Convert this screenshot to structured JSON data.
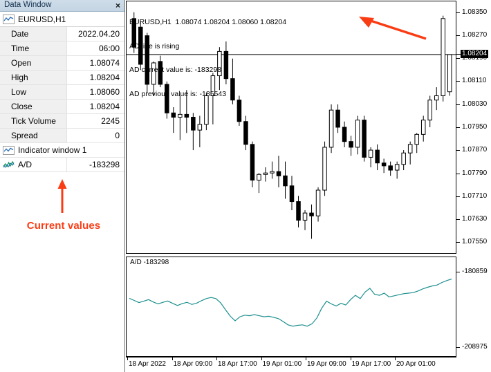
{
  "data_window": {
    "title": "Data Window",
    "close_label": "×",
    "symbol_row": {
      "icon": "chart-line-icon",
      "label": "EURUSD,H1"
    },
    "rows": [
      {
        "label": "Date",
        "value": "2022.04.20"
      },
      {
        "label": "Time",
        "value": "06:00"
      },
      {
        "label": "Open",
        "value": "1.08074"
      },
      {
        "label": "High",
        "value": "1.08204"
      },
      {
        "label": "Low",
        "value": "1.08060"
      },
      {
        "label": "Close",
        "value": "1.08204"
      },
      {
        "label": "Tick Volume",
        "value": "2245"
      },
      {
        "label": "Spread",
        "value": "0"
      }
    ],
    "group": {
      "icon": "chart-line-icon",
      "label": "Indicator window 1"
    },
    "indicator_row": {
      "icon": "indicator-zigzag-icon",
      "label": "A/D",
      "value": "-183298"
    },
    "annotation": {
      "text": "Current values",
      "color": "#fa3c14",
      "arrow": "arrow-up-icon"
    }
  },
  "chart": {
    "header_lines": [
      "EURUSD,H1  1.08074 1.08204 1.08060 1.08204",
      "AD line is rising",
      "AD current value is: -183298",
      "AD previous value is: -185543"
    ],
    "annotation_arrow": "arrow-up-left-icon",
    "current_price": "1.08204",
    "indicator_label": "A/D -183298"
  },
  "chart_data": {
    "type": "candlestick",
    "title": "EURUSD,H1",
    "symbol": "EURUSD",
    "timeframe": "H1",
    "xlabel": "",
    "ylabel": "",
    "grid": false,
    "legend": "none",
    "price_axis": {
      "ticks": [
        "1.08350",
        "1.08270",
        "1.08190",
        "1.08110",
        "1.08030",
        "1.07950",
        "1.07870",
        "1.07790",
        "1.07710",
        "1.07630",
        "1.07550"
      ],
      "ylim": [
        1.0751,
        1.0839
      ],
      "current_price": "1.08204",
      "current_price_highlight": true
    },
    "time_axis": {
      "ticks": [
        "18 Apr 2022",
        "18 Apr 09:00",
        "18 Apr 17:00",
        "19 Apr 01:00",
        "19 Apr 09:00",
        "19 Apr 17:00",
        "20 Apr 01:00"
      ]
    },
    "ohlc": [
      {
        "o": 1.0833,
        "h": 1.08352,
        "l": 1.0821,
        "c": 1.0823
      },
      {
        "o": 1.083,
        "h": 1.0832,
        "l": 1.0815,
        "c": 1.0817
      },
      {
        "o": 1.0827,
        "h": 1.0828,
        "l": 1.0807,
        "c": 1.081
      },
      {
        "o": 1.081,
        "h": 1.0818,
        "l": 1.0806,
        "c": 1.08175
      },
      {
        "o": 1.0818,
        "h": 1.082,
        "l": 1.0809,
        "c": 1.081
      },
      {
        "o": 1.081,
        "h": 1.0811,
        "l": 1.0798,
        "c": 1.08
      },
      {
        "o": 1.08,
        "h": 1.0802,
        "l": 1.0793,
        "c": 1.07985
      },
      {
        "o": 1.07985,
        "h": 1.0806,
        "l": 1.07905,
        "c": 1.07995
      },
      {
        "o": 1.07995,
        "h": 1.0808,
        "l": 1.0793,
        "c": 1.07985
      },
      {
        "o": 1.07985,
        "h": 1.08,
        "l": 1.0787,
        "c": 1.0794
      },
      {
        "o": 1.0794,
        "h": 1.0799,
        "l": 1.0788,
        "c": 1.0796
      },
      {
        "o": 1.0796,
        "h": 1.0807,
        "l": 1.0794,
        "c": 1.0806
      },
      {
        "o": 1.0806,
        "h": 1.0814,
        "l": 1.0796,
        "c": 1.0813
      },
      {
        "o": 1.0813,
        "h": 1.0823,
        "l": 1.0808,
        "c": 1.08215
      },
      {
        "o": 1.08215,
        "h": 1.0825,
        "l": 1.081,
        "c": 1.0812
      },
      {
        "o": 1.0812,
        "h": 1.0819,
        "l": 1.0803,
        "c": 1.08045
      },
      {
        "o": 1.08045,
        "h": 1.0806,
        "l": 1.07955,
        "c": 1.0797
      },
      {
        "o": 1.0797,
        "h": 1.0799,
        "l": 1.0787,
        "c": 1.0789
      },
      {
        "o": 1.0789,
        "h": 1.079,
        "l": 1.0774,
        "c": 1.07765
      },
      {
        "o": 1.07765,
        "h": 1.0779,
        "l": 1.0772,
        "c": 1.07785
      },
      {
        "o": 1.07785,
        "h": 1.0781,
        "l": 1.0776,
        "c": 1.0779
      },
      {
        "o": 1.0779,
        "h": 1.0783,
        "l": 1.0777,
        "c": 1.07795
      },
      {
        "o": 1.07795,
        "h": 1.0785,
        "l": 1.0774,
        "c": 1.0778
      },
      {
        "o": 1.0778,
        "h": 1.0783,
        "l": 1.077,
        "c": 1.07745
      },
      {
        "o": 1.07745,
        "h": 1.0778,
        "l": 1.0766,
        "c": 1.0769
      },
      {
        "o": 1.0769,
        "h": 1.0771,
        "l": 1.076,
        "c": 1.07625
      },
      {
        "o": 1.07625,
        "h": 1.0766,
        "l": 1.0759,
        "c": 1.0765
      },
      {
        "o": 1.0765,
        "h": 1.0768,
        "l": 1.0756,
        "c": 1.0764
      },
      {
        "o": 1.0764,
        "h": 1.0774,
        "l": 1.0762,
        "c": 1.0773
      },
      {
        "o": 1.0773,
        "h": 1.079,
        "l": 1.0771,
        "c": 1.0788
      },
      {
        "o": 1.0788,
        "h": 1.0803,
        "l": 1.0786,
        "c": 1.0801
      },
      {
        "o": 1.0801,
        "h": 1.0803,
        "l": 1.0793,
        "c": 1.0795
      },
      {
        "o": 1.0795,
        "h": 1.0797,
        "l": 1.0788,
        "c": 1.079
      },
      {
        "o": 1.079,
        "h": 1.0792,
        "l": 1.0785,
        "c": 1.0788
      },
      {
        "o": 1.0788,
        "h": 1.0799,
        "l": 1.07855,
        "c": 1.07975
      },
      {
        "o": 1.07975,
        "h": 1.0799,
        "l": 1.0783,
        "c": 1.07845
      },
      {
        "o": 1.07845,
        "h": 1.0788,
        "l": 1.0781,
        "c": 1.0787
      },
      {
        "o": 1.0787,
        "h": 1.0789,
        "l": 1.078,
        "c": 1.07825
      },
      {
        "o": 1.07825,
        "h": 1.0784,
        "l": 1.0779,
        "c": 1.07815
      },
      {
        "o": 1.07815,
        "h": 1.0783,
        "l": 1.0778,
        "c": 1.078
      },
      {
        "o": 1.078,
        "h": 1.0783,
        "l": 1.0777,
        "c": 1.0782
      },
      {
        "o": 1.0782,
        "h": 1.0787,
        "l": 1.078,
        "c": 1.0786
      },
      {
        "o": 1.0786,
        "h": 1.079,
        "l": 1.0782,
        "c": 1.0789
      },
      {
        "o": 1.0789,
        "h": 1.0793,
        "l": 1.0786,
        "c": 1.07925
      },
      {
        "o": 1.07925,
        "h": 1.0799,
        "l": 1.079,
        "c": 1.07975
      },
      {
        "o": 1.07975,
        "h": 1.0806,
        "l": 1.0795,
        "c": 1.08045
      },
      {
        "o": 1.08045,
        "h": 1.0809,
        "l": 1.0801,
        "c": 1.0806
      },
      {
        "o": 1.0806,
        "h": 1.0834,
        "l": 1.0804,
        "c": 1.0833
      },
      {
        "o": 1.08074,
        "h": 1.08204,
        "l": 1.0806,
        "c": 1.08204
      }
    ],
    "indicator": {
      "name": "A/D",
      "type": "line",
      "color": "#1d8f8f",
      "current_value": "-183298",
      "previous_value": "-185543",
      "ylim": [
        -208975,
        -180859
      ],
      "yticks": [
        "-180859",
        "-208975"
      ],
      "values": [
        -190500,
        -191300,
        -192100,
        -191600,
        -191000,
        -191900,
        -192600,
        -192000,
        -191500,
        -192400,
        -193200,
        -192500,
        -192000,
        -192800,
        -192300,
        -191400,
        -190600,
        -190200,
        -190600,
        -192200,
        -194800,
        -197200,
        -198900,
        -197400,
        -196800,
        -197000,
        -196600,
        -197000,
        -197400,
        -197200,
        -197600,
        -198100,
        -199200,
        -200400,
        -200900,
        -200600,
        -200400,
        -200900,
        -200000,
        -197800,
        -194200,
        -191600,
        -192600,
        -193400,
        -192400,
        -193000,
        -191000,
        -189400,
        -190600,
        -188200,
        -186800,
        -189000,
        -189400,
        -188600,
        -190000,
        -189600,
        -189200,
        -188800,
        -188600,
        -188400,
        -187800,
        -187000,
        -186400,
        -185900,
        -185543,
        -184600,
        -183900,
        -183298
      ]
    }
  }
}
